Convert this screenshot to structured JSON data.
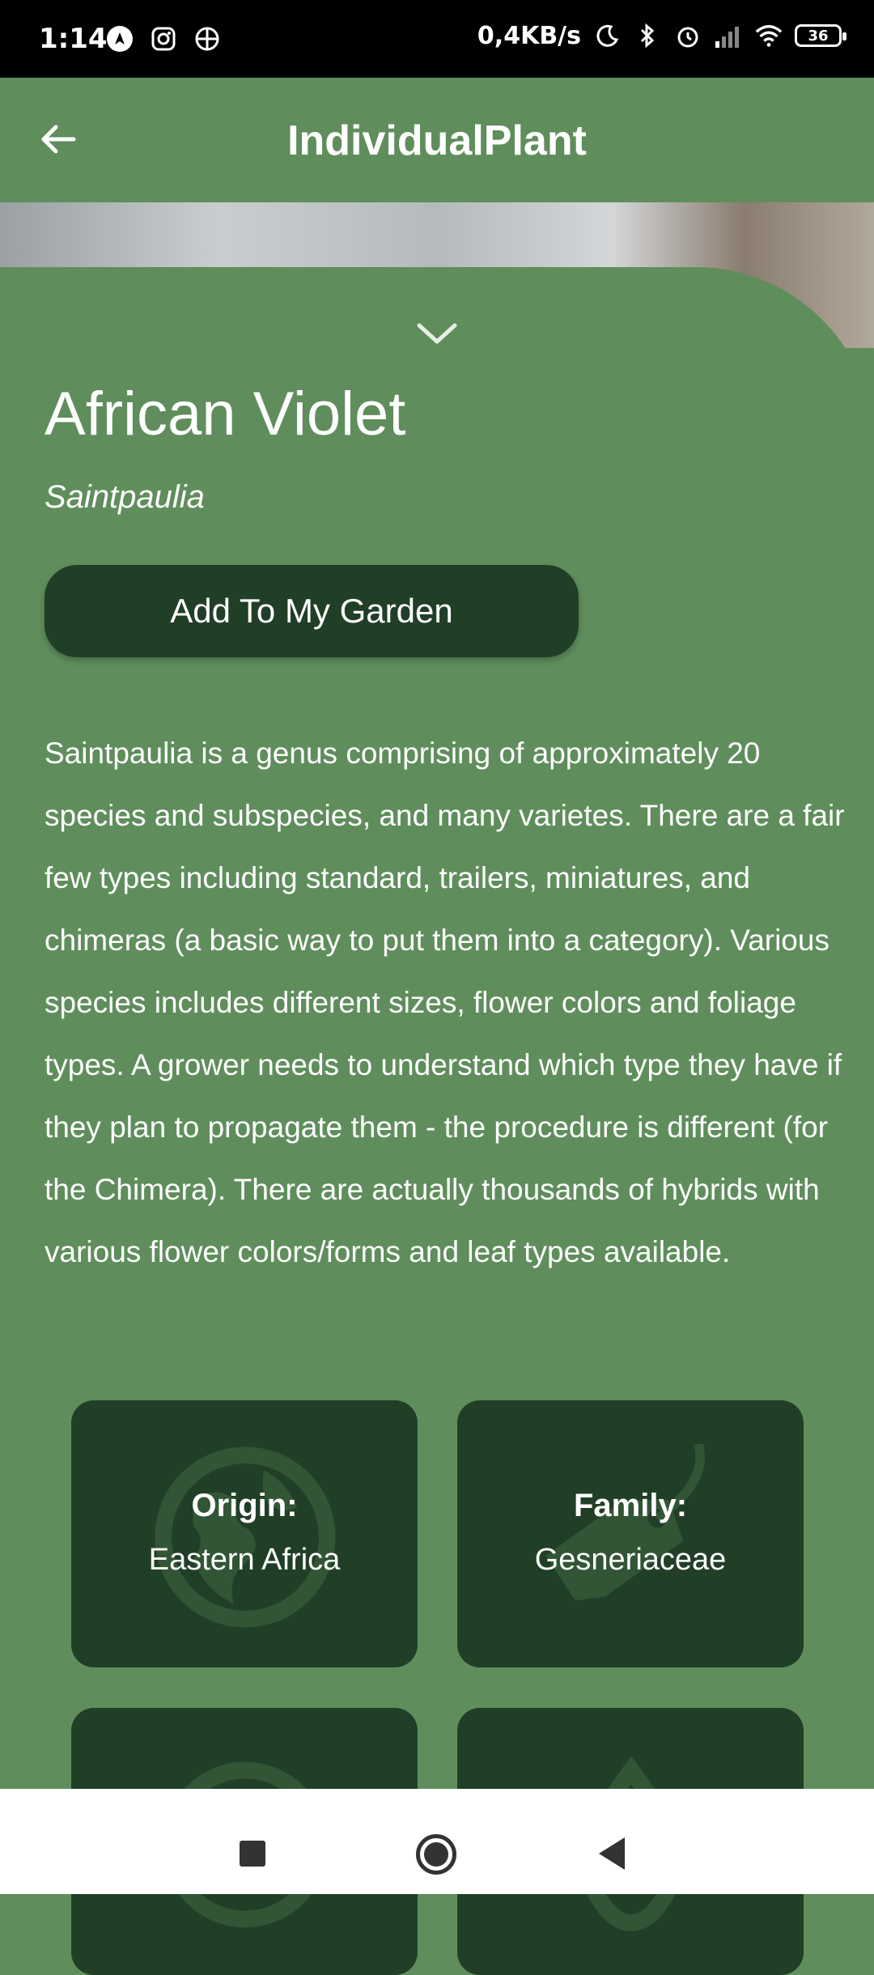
{
  "status_bar": {
    "time": "1:14",
    "net_speed": "0,4KB/s",
    "battery": "36"
  },
  "app_bar": {
    "title": "IndividualPlant"
  },
  "plant": {
    "name": "African Violet",
    "scientific_name": "Saintpaulia",
    "add_button_label": "Add To My Garden",
    "description": " Saintpaulia is a genus comprising of approximately 20 species and subspecies, and many varietes. There are a fair few types including standard, trailers, miniatures, and chimeras (a basic way to put them into a category). Various species includes different sizes, flower colors and foliage types. A grower needs to understand which type they have if they plan to propagate them - the procedure is different (for the Chimera). There are actually thousands of hybrids with various flower colors/forms and leaf types available."
  },
  "cards": [
    {
      "label": "Origin:",
      "value": "Eastern Africa",
      "icon": "globe-icon"
    },
    {
      "label": "Family:",
      "value": "Gesneriaceae",
      "icon": "tag-icon"
    },
    {
      "icon": "sun-icon"
    },
    {
      "icon": "drop-icon"
    }
  ],
  "colors": {
    "background": "#5f8e5c",
    "card": "#213f27",
    "button": "#213f27"
  }
}
